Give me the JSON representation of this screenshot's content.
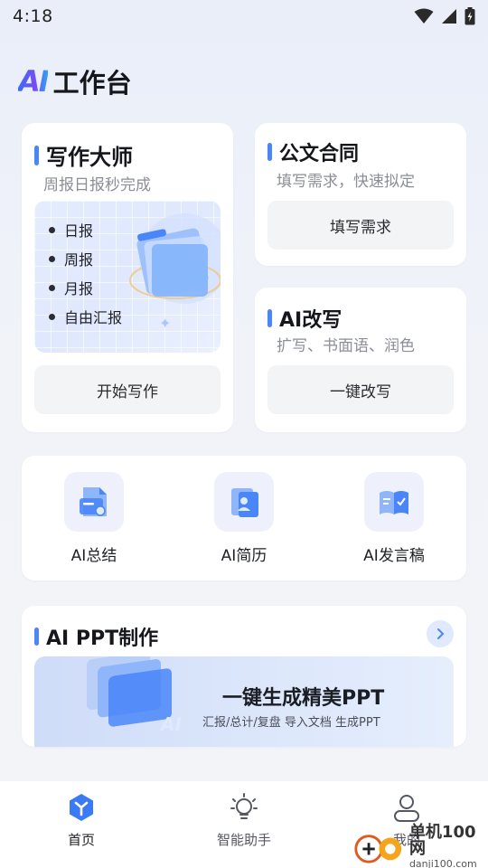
{
  "status_bar": {
    "time": "4:18"
  },
  "header": {
    "logo_text": "AI",
    "title": "工作台"
  },
  "writing_card": {
    "title": "写作大师",
    "subtitle": "周报日报秒完成",
    "items": [
      "日报",
      "周报",
      "月报",
      "自由汇报"
    ],
    "button_label": "开始写作"
  },
  "official_card": {
    "title": "公文合同",
    "subtitle": "填写需求，快速拟定",
    "button_label": "填写需求"
  },
  "rewrite_card": {
    "title": "AI改写",
    "subtitle": "扩写、书面语、润色",
    "button_label": "一键改写"
  },
  "tools": [
    {
      "label": "AI总结",
      "icon": "summary-doc-icon"
    },
    {
      "label": "AI简历",
      "icon": "resume-icon"
    },
    {
      "label": "AI发言稿",
      "icon": "speech-book-icon"
    }
  ],
  "ppt_card": {
    "title": "AI PPT制作",
    "banner_headline": "一键生成精美PPT",
    "banner_subline": "汇报/总计/复盘 导入文档 生成PPT",
    "banner_logo": "AI"
  },
  "bottom_nav": [
    {
      "label": "首页",
      "icon": "home-icon",
      "active": true
    },
    {
      "label": "智能助手",
      "icon": "lightbulb-icon",
      "active": false
    },
    {
      "label": "我的",
      "icon": "person-icon",
      "active": false
    }
  ],
  "watermark": {
    "cn": "单机100网",
    "en": "danji100.com"
  },
  "colors": {
    "accent": "#4a86f8",
    "background": "#f1f3f9"
  }
}
